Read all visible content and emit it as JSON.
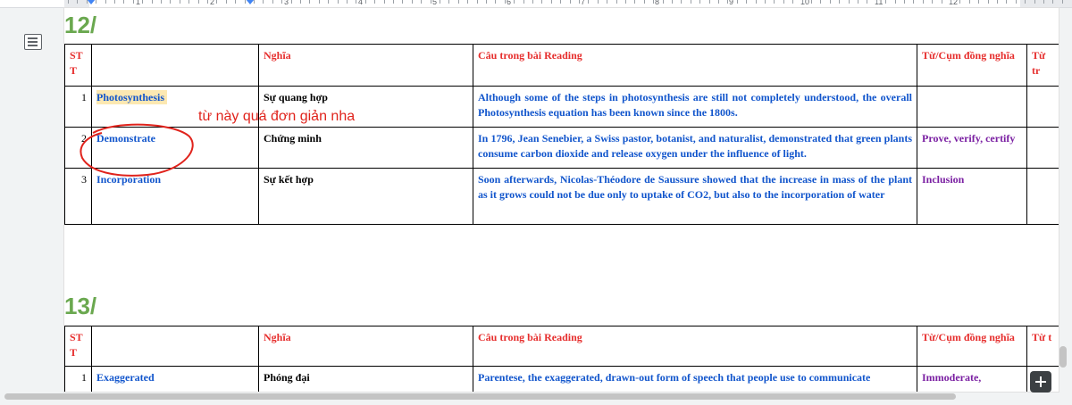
{
  "ruler": {
    "numbers": [
      "1",
      "2",
      "3",
      "4",
      "5",
      "6",
      "7",
      "8",
      "9",
      "10",
      "11",
      "12"
    ]
  },
  "sections": [
    {
      "title": "12/",
      "headers": {
        "stt": "ST T",
        "word": "",
        "meaning": "Nghĩa",
        "sentence": "Câu trong bài Reading",
        "synonym": "Từ/Cụm đồng nghĩa",
        "more": "Từ tr"
      },
      "rows": [
        {
          "num": "1",
          "word": "Photosynthesis",
          "meaning": "Sự quang hợp",
          "sentence": "Although some of the steps in photosynthesis are still not completely understood, the overall Photosynthesis equation has been known since the 1800s.",
          "synonym": "",
          "more": ""
        },
        {
          "num": "2",
          "word": "Demonstrate",
          "meaning": "Chứng minh",
          "sentence": "In 1796, Jean Senebier, a Swiss pastor, botanist, and naturalist, demonstrated that green plants consume carbon dioxide and release oxygen under the influence of light.",
          "synonym": "Prove, verify, certify",
          "more": ""
        },
        {
          "num": "3",
          "word": "Incorporation",
          "meaning": "Sự kết hợp",
          "sentence": "Soon afterwards, Nicolas-Théodore de Saussure showed that the increase in mass of the plant as it grows could not be due only to uptake of CO2, but also to the incorporation of water",
          "synonym": "Inclusion",
          "more": ""
        }
      ]
    },
    {
      "title": "13/",
      "headers": {
        "stt": "ST T",
        "word": "",
        "meaning": "Nghĩa",
        "sentence": "Câu trong bài Reading",
        "synonym": "Từ/Cụm đồng nghĩa",
        "more": "Từ t"
      },
      "rows": [
        {
          "num": "1",
          "word": "Exaggerated",
          "meaning": "Phóng đại",
          "sentence": "Parentese, the exaggerated, drawn-out form of speech that people use to communicate",
          "synonym": "Immoderate,",
          "more": ""
        }
      ]
    }
  ],
  "annotation": {
    "note": "từ này quá đơn giản nha",
    "color": "#e0231c"
  },
  "colors": {
    "heading": "#6aa84f",
    "header_text": "#e62e2d",
    "word": "#1155cc",
    "synonym": "#7a1fa2",
    "highlight": "#fce8b2"
  },
  "icons": {
    "outline": "document-outline-icon",
    "explore": "add-comment-icon"
  }
}
